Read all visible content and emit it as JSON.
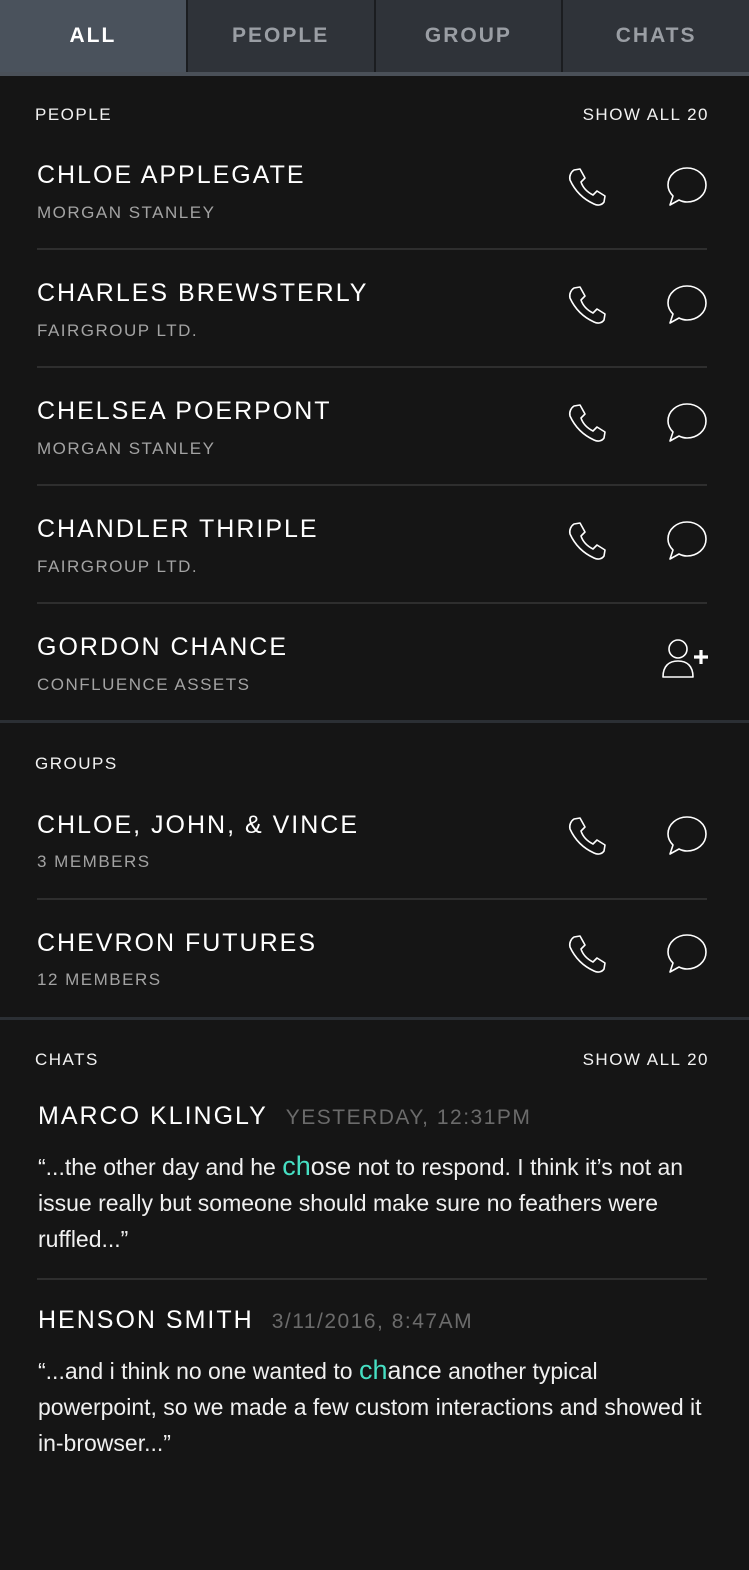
{
  "tabs": [
    {
      "label": "ALL",
      "active": true
    },
    {
      "label": "PEOPLE",
      "active": false
    },
    {
      "label": "GROUP",
      "active": false
    },
    {
      "label": "CHATS",
      "active": false
    }
  ],
  "people": {
    "title": "PEOPLE",
    "show_all": "SHOW ALL 20",
    "items": [
      {
        "name": "CHLOE APPLEGATE",
        "company": "MORGAN STANLEY",
        "actions": [
          "phone-icon",
          "chat-bubble-icon"
        ]
      },
      {
        "name": "CHARLES BREWSTERLY",
        "company": "FAIRGROUP LTD.",
        "actions": [
          "phone-icon",
          "chat-bubble-icon"
        ]
      },
      {
        "name": "CHELSEA POERPONT",
        "company": "MORGAN STANLEY",
        "actions": [
          "phone-icon",
          "chat-bubble-icon"
        ]
      },
      {
        "name": "CHANDLER THRIPLE",
        "company": "FAIRGROUP LTD.",
        "actions": [
          "phone-icon",
          "chat-bubble-icon"
        ]
      },
      {
        "name": "GORDON CHANCE",
        "company": "CONFLUENCE ASSETS",
        "actions": [
          "add-contact-icon"
        ]
      }
    ]
  },
  "groups": {
    "title": "GROUPS",
    "items": [
      {
        "name": "CHLOE, JOHN, & VINCE",
        "members": "3 MEMBERS"
      },
      {
        "name": "CHEVRON FUTURES",
        "members": "12 MEMBERS"
      }
    ]
  },
  "chats": {
    "title": "CHATS",
    "show_all": "SHOW ALL 20",
    "items": [
      {
        "sender": "MARCO KLINGLY",
        "time": "YESTERDAY, 12:31PM",
        "msg_before": "“...the other day and he ",
        "msg_hl": "ch",
        "msg_mid": "ose",
        "msg_after": " not to respond. I think it’s not an issue really but someone should make sure no feathers were ruffled...”"
      },
      {
        "sender": "HENSON SMITH",
        "time": "3/11/2016, 8:47AM",
        "msg_before": "“...and i think no one wanted to ",
        "msg_hl": "ch",
        "msg_mid": "ance",
        "msg_after": " another typical powerpoint, so we made a few custom interactions and showed it in-browser...”"
      }
    ]
  },
  "colors": {
    "accent": "#46dfc3",
    "background": "#151515",
    "tab_bar": "#2f3339",
    "tab_active": "#4a525c"
  }
}
